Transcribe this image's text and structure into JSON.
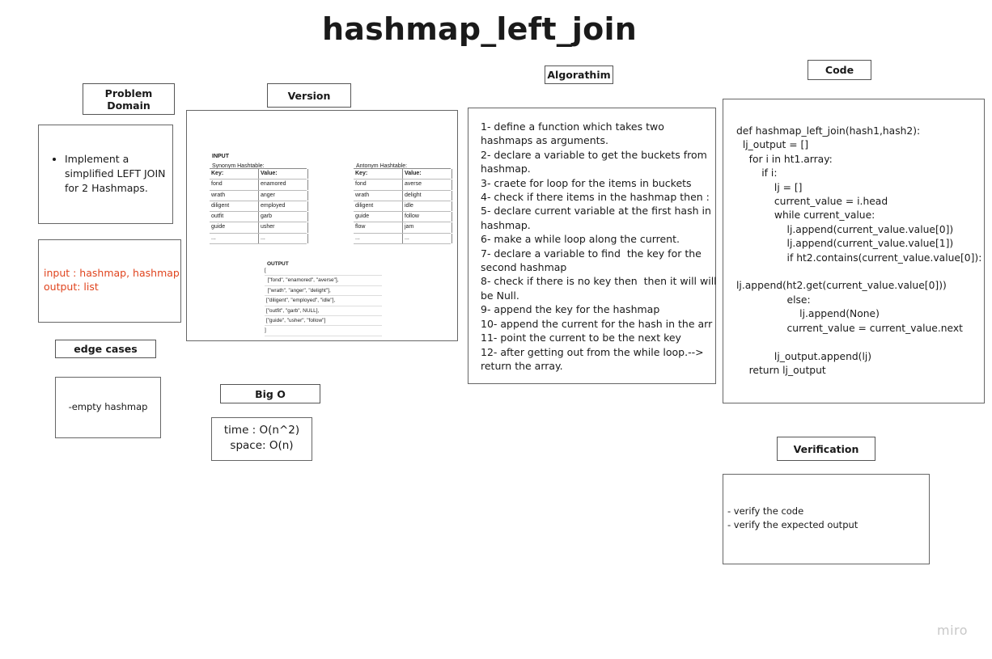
{
  "title": "hashmap_left_join",
  "labels": {
    "problem_domain": "Problem Domain",
    "version": "Version",
    "algorithm": "Algorathim",
    "code": "Code",
    "edge_cases": "edge cases",
    "big_o": "Big O",
    "verification": "Verification"
  },
  "problem_domain": {
    "bullet": "Implement a simplified LEFT JOIN for 2 Hashmaps.",
    "io_input": "input : hashmap, hashmap",
    "io_output": "output: list"
  },
  "edge_cases": {
    "text": "-empty hashmap"
  },
  "big_o": {
    "time": "time : O(n^2)",
    "space": "space: O(n)"
  },
  "version": {
    "input_label": "INPUT",
    "synonym": {
      "caption": "Synonym Hashtable:",
      "headers": [
        "Key:",
        "Value:"
      ],
      "rows": [
        [
          "fond",
          "enamored"
        ],
        [
          "wrath",
          "anger"
        ],
        [
          "diligent",
          "employed"
        ],
        [
          "outfit",
          "garb"
        ],
        [
          "guide",
          "usher"
        ],
        [
          "...",
          "..."
        ]
      ]
    },
    "antonym": {
      "caption": "Antonym Hashtable:",
      "headers": [
        "Key:",
        "Value:"
      ],
      "rows": [
        [
          "fond",
          "averse"
        ],
        [
          "wrath",
          "delight"
        ],
        [
          "diligent",
          "idle"
        ],
        [
          "guide",
          "follow"
        ],
        [
          "flow",
          "jam"
        ],
        [
          "...",
          "..."
        ]
      ]
    },
    "output_label": "OUTPUT",
    "output_lines": [
      "[",
      "  [\"fond\", \"enamored\", \"averse\"],",
      "  [\"wrath\", \"anger\", \"delight\"],",
      " [\"diligent\", \"employed\", \"idle\"],",
      " [\"outfit\", \"garb\", NULL],",
      " [\"guide\", \"usher\", \"follow\"]",
      "]"
    ]
  },
  "algorithm": {
    "text": "1- define a function which takes two\nhashmaps as arguments.\n2- declare a variable to get the buckets from\nhashmap.\n3- craete for loop for the items in buckets\n4- check if there items in the hashmap then :\n5- declare current variable at the first hash in\nhashmap.\n6- make a while loop along the current.\n7- declare a variable to find  the key for the\nsecond hashmap\n8- check if there is no key then  then it will will\nbe Null.\n9- append the key for the hashmap\n10- append the current for the hash in the arr\n11- point the current to be the next key\n12- after getting out from the while loop.-->\nreturn the array."
  },
  "code": {
    "text": "def hashmap_left_join(hash1,hash2):\n  lj_output = []\n    for i in ht1.array:\n        if i:\n            lj = []\n            current_value = i.head\n            while current_value:\n                lj.append(current_value.value[0])\n                lj.append(current_value.value[1])\n                if ht2.contains(current_value.value[0]):\n\nlj.append(ht2.get(current_value.value[0]))\n                else:\n                    lj.append(None)\n                current_value = current_value.next\n\n            lj_output.append(lj)\n    return lj_output"
  },
  "verification": {
    "line1": "- verify the code",
    "line2": "- verify the expected output"
  },
  "watermark": "miro"
}
